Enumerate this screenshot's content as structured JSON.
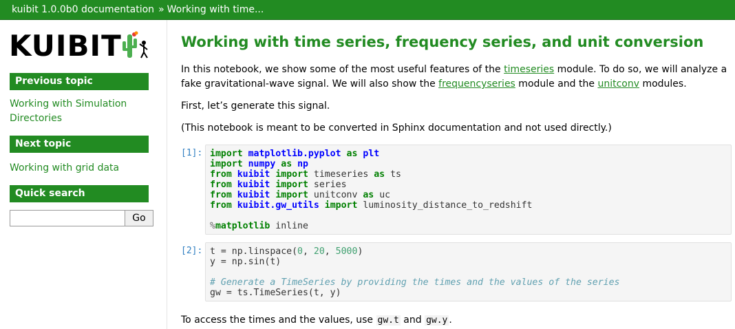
{
  "topbar": {
    "project": "kuibit 1.0.0b0 documentation",
    "separator": "»",
    "current": "Working with time..."
  },
  "sidebar": {
    "logo_text": "KUIBIT",
    "previous_heading": "Previous topic",
    "previous_link": "Working with Simulation Directories",
    "next_heading": "Next topic",
    "next_link": "Working with grid data",
    "search_heading": "Quick search",
    "search_value": "",
    "search_button": "Go"
  },
  "main": {
    "title": "Working with time series, frequency series, and unit conversion",
    "intro": {
      "t1": "In this notebook, we show some of the most useful features of the ",
      "l1": "timeseries",
      "t2": " module. To do so, we will analyze a fake gravitational-wave signal. We will also show the ",
      "l2": "frequencyseries",
      "t3": " module and the ",
      "l3": "unitconv",
      "t4": " modules."
    },
    "first": "First, let’s generate this signal.",
    "note": "(This notebook is meant to be converted in Sphinx documentation and not used directly.)",
    "prompt1": "[1]:",
    "prompt2": "[2]:",
    "outro": {
      "t1": "To access the times and the values, use ",
      "c1": "gw.t",
      "t2": " and ",
      "c2": "gw.y",
      "t3": "."
    }
  },
  "colors": {
    "accent": "#228b22",
    "prompt": "#307fc1"
  },
  "icons": [
    "cactus-icon",
    "person-icon"
  ]
}
